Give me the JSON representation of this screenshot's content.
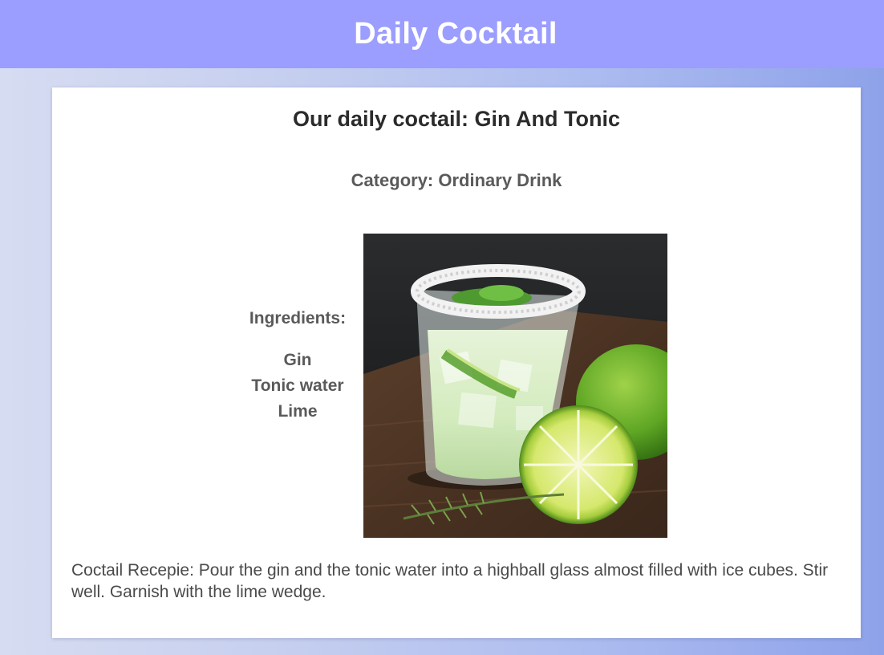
{
  "header": {
    "title": "Daily Cocktail"
  },
  "cocktail": {
    "title": "Our daily coctail: Gin And Tonic",
    "category": "Category: Ordinary Drink",
    "ingredients_heading": "Ingredients:",
    "ingredients": [
      "Gin",
      "Tonic water",
      "Lime"
    ],
    "recipe": "Coctail Recepie: Pour the gin and the tonic water into a highball glass almost filled with ice cubes. Stir well. Garnish with the lime wedge."
  },
  "colors": {
    "header_bg": "#9b9dff",
    "card_bg": "#ffffff",
    "title_text": "#2b2b2b",
    "muted_text": "#5a5a5a"
  }
}
